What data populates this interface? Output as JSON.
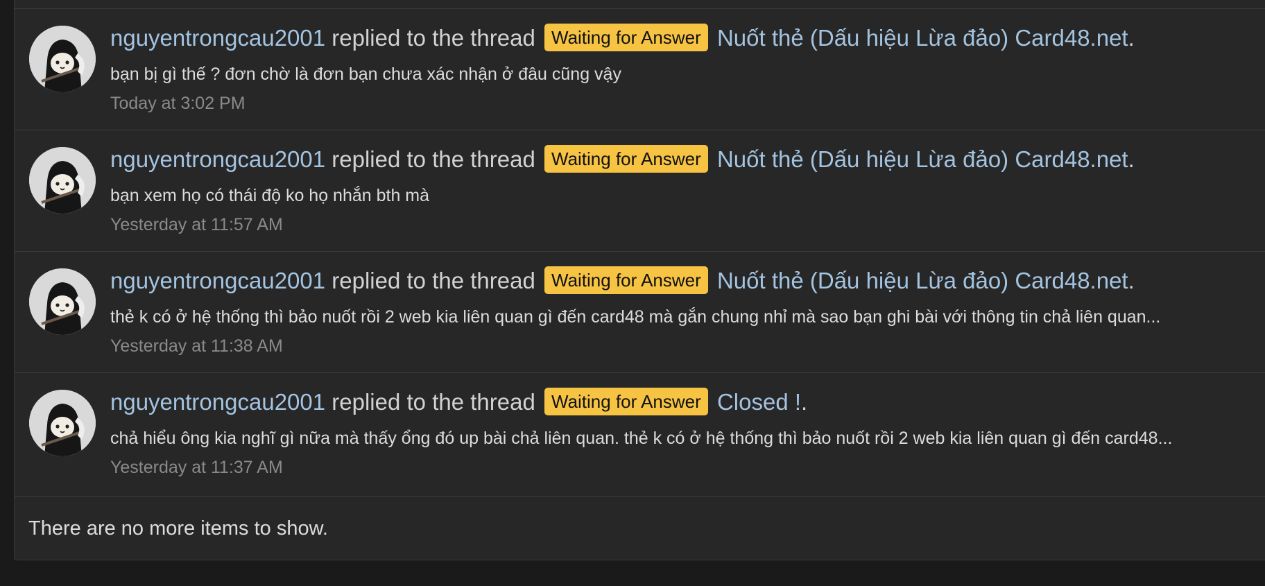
{
  "items": [
    {
      "username": "nguyentrongcau2001",
      "action": "replied to the thread",
      "prefix_label": "Waiting for Answer",
      "thread_title": "Nuốt thẻ (Dấu hiệu Lừa đảo) Card48.net",
      "snippet": "bạn bị gì thế ? đơn chờ là đơn bạn chưa xác nhận ở đâu cũng vậy",
      "time": "Today at 3:02 PM"
    },
    {
      "username": "nguyentrongcau2001",
      "action": "replied to the thread",
      "prefix_label": "Waiting for Answer",
      "thread_title": "Nuốt thẻ (Dấu hiệu Lừa đảo) Card48.net",
      "snippet": "bạn xem họ có thái độ ko họ nhắn bth mà",
      "time": "Yesterday at 11:57 AM"
    },
    {
      "username": "nguyentrongcau2001",
      "action": "replied to the thread",
      "prefix_label": "Waiting for Answer",
      "thread_title": "Nuốt thẻ (Dấu hiệu Lừa đảo) Card48.net",
      "snippet": "thẻ k có ở hệ thống thì bảo nuốt rồi 2 web kia liên quan gì đến card48 mà gắn chung nhỉ mà sao bạn ghi bài với thông tin chả liên quan...",
      "time": "Yesterday at 11:38 AM"
    },
    {
      "username": "nguyentrongcau2001",
      "action": "replied to the thread",
      "prefix_label": "Waiting for Answer",
      "thread_title": "Closed !",
      "snippet": "chả hiểu ông kia nghĩ gì nữa mà thấy ổng đó up bài chả liên quan. thẻ k có ở hệ thống thì bảo nuốt rồi 2 web kia liên quan gì đến card48...",
      "time": "Yesterday at 11:37 AM"
    }
  ],
  "footer": {
    "text": "There are no more items to show."
  },
  "colors": {
    "background": "#1a1a1a",
    "panel": "#272727",
    "link": "#a3c3e0",
    "label_bg": "#f6c343",
    "muted": "#8a8a8a"
  },
  "icons": {
    "avatar": "avatar-image"
  }
}
